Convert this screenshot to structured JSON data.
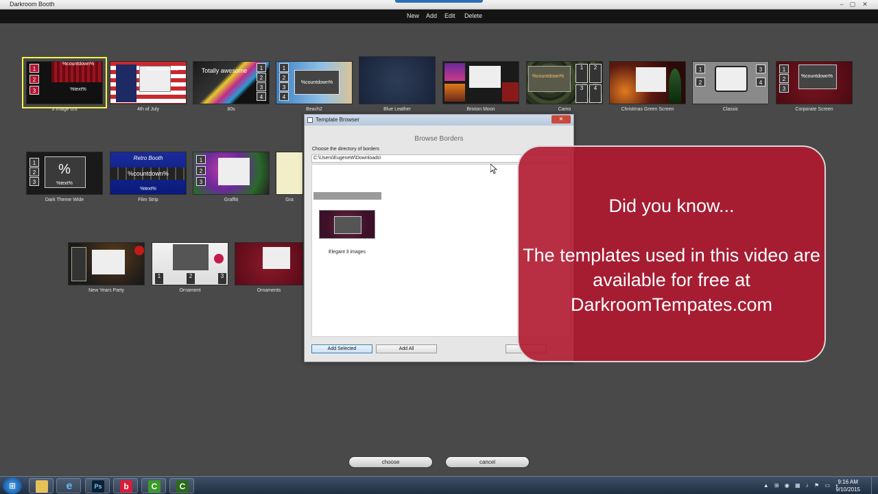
{
  "window": {
    "title": "Darkroom Booth",
    "minimize": "–",
    "maximize": "▢",
    "close": "✕"
  },
  "menu": {
    "new": "New",
    "add": "Add",
    "edit": "Edit",
    "delete": "Delete"
  },
  "templates": [
    {
      "label": "3 Image GS",
      "selected": true
    },
    {
      "label": "4th of July"
    },
    {
      "label": "80s"
    },
    {
      "label": "Beach2"
    },
    {
      "label": "Blue Leather"
    },
    {
      "label": "Brixton Moon"
    },
    {
      "label": "Camo"
    },
    {
      "label": "Christmas Green Screen"
    },
    {
      "label": "Classic"
    },
    {
      "label": "Corporate Screen"
    },
    {
      "label": "Dark Theme Wide"
    },
    {
      "label": "Film Strip"
    },
    {
      "label": "Graffiti"
    },
    {
      "label": "Gra"
    },
    {
      "label": "New Years Party"
    },
    {
      "label": "Ornament"
    },
    {
      "label": "Ornaments"
    }
  ],
  "thumb_text": {
    "countdown": "%countdown%",
    "text": "%text%",
    "retro": "Retro Booth",
    "percent": "%",
    "total": "Totally awesome",
    "c1": "1",
    "c2": "2",
    "c3": "3",
    "c4": "4"
  },
  "dialog": {
    "title": "Template Browser",
    "close": "✕",
    "heading": "Browse Borders",
    "dir_label": "Choose the directory of borders",
    "path": "C:\\Users\\EugeneW\\Downloads\\",
    "item_label": "Elegant 3 images",
    "add_selected": "Add Selected",
    "add_all": "Add All"
  },
  "overlay": {
    "line1": "Did you know...",
    "line2": "The templates used in this video are available for free at DarkroomTempates.com"
  },
  "buttons": {
    "choose": "choose",
    "cancel": "cancel"
  },
  "taskbar": {
    "time": "9:16 AM",
    "date": "9/10/2015",
    "ps": "Ps",
    "b": "b",
    "c1": "C",
    "c2": "C"
  },
  "colors": {
    "menubar": "#141414",
    "overlay": "#b01830",
    "selection": "#f6f64a"
  }
}
